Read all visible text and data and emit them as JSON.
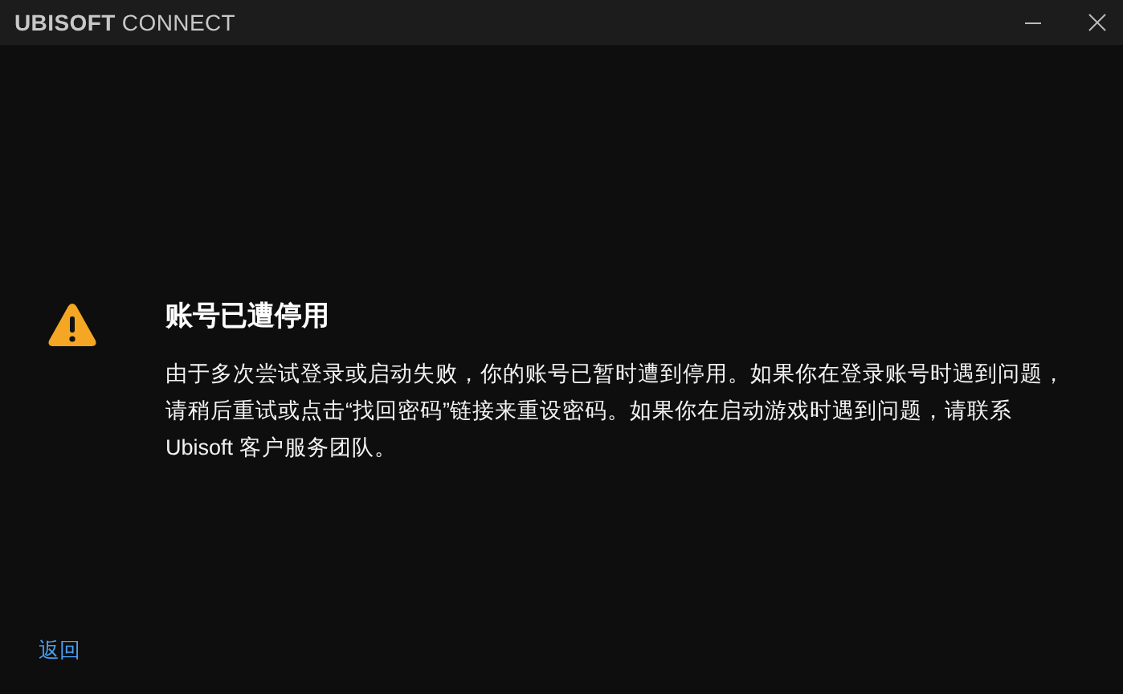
{
  "window": {
    "title": "**UBISOFT** CONNECT"
  },
  "message": {
    "heading": "账号已遭停用",
    "body": "由于多次尝试登录或启动失败，你的账号已暂时遭到停用。如果你在登录账号时遇到问题，请稍后重试或点击“找回密码”链接来重设密码。如果你在启动游戏时遇到问题，请联系 Ubisoft 客户服务团队。"
  },
  "back_link": "返回"
}
